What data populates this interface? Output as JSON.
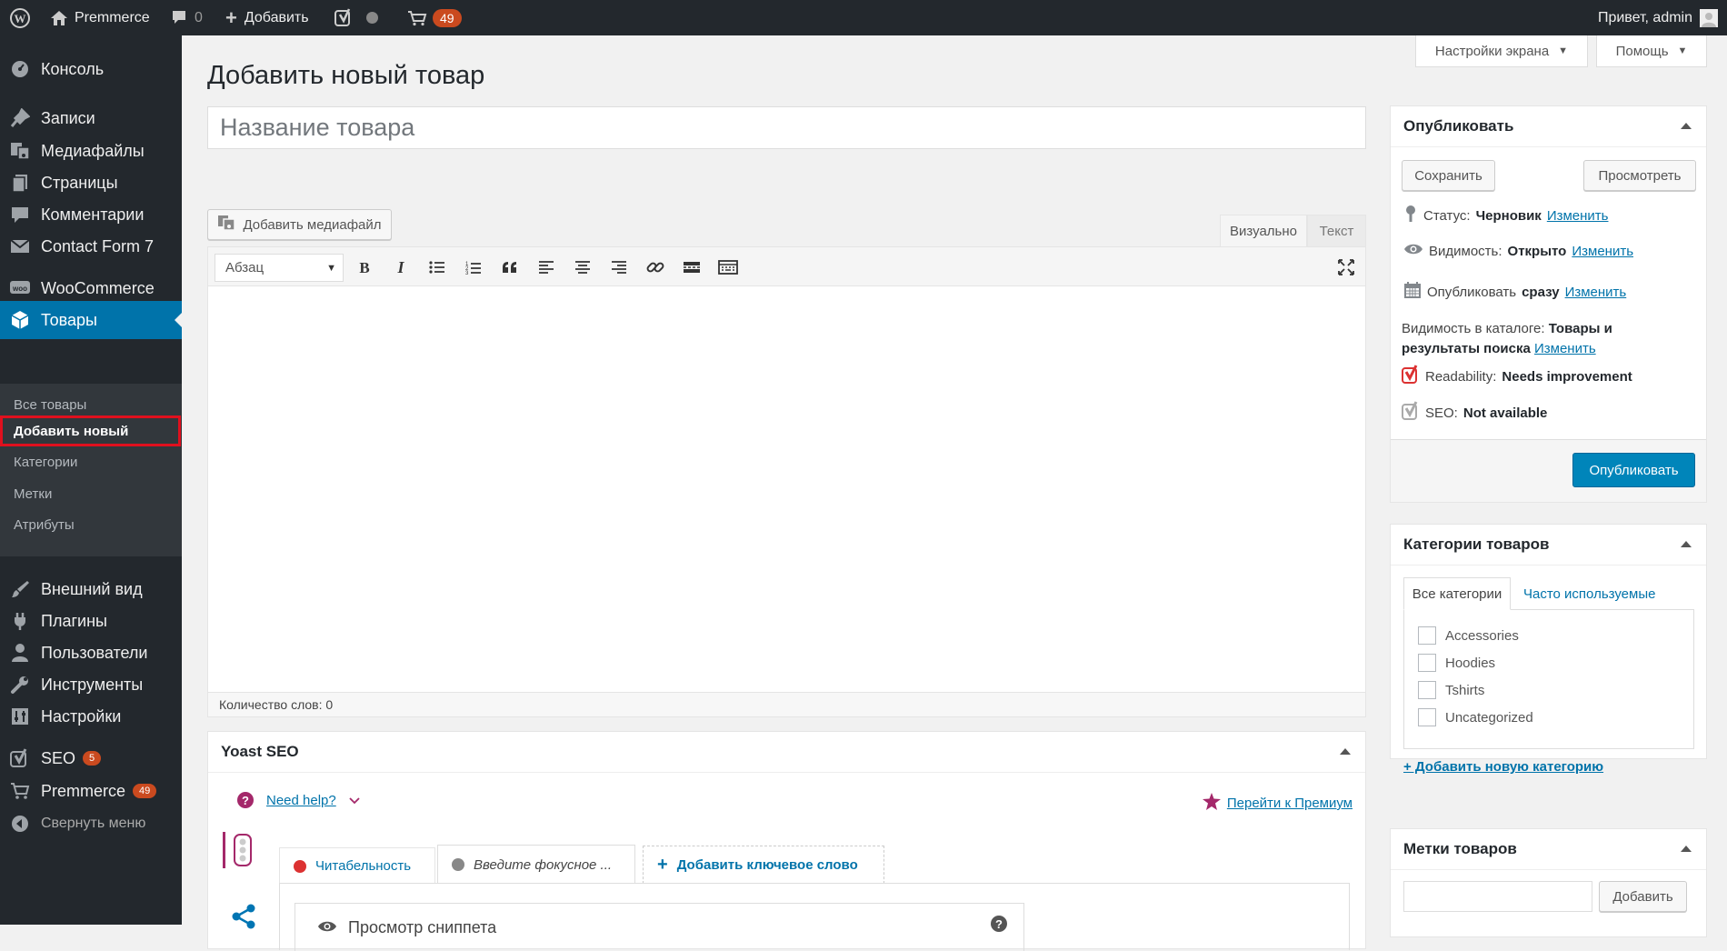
{
  "adminbar": {
    "site_name": "Premmerce",
    "comments_count": "0",
    "add_label": "Добавить",
    "cart_count": "49",
    "greeting": "Привет, admin"
  },
  "sidebar": {
    "items": [
      {
        "label": "Консоль",
        "icon": "dashboard-icon"
      },
      {
        "label": "Записи",
        "icon": "pin-icon"
      },
      {
        "label": "Медиафайлы",
        "icon": "media-icon"
      },
      {
        "label": "Страницы",
        "icon": "pages-icon"
      },
      {
        "label": "Комментарии",
        "icon": "comments-icon"
      },
      {
        "label": "Contact Form 7",
        "icon": "mail-icon"
      },
      {
        "label": "WooCommerce",
        "icon": "woo-icon"
      },
      {
        "label": "Товары",
        "icon": "box-icon"
      },
      {
        "label": "Внешний вид",
        "icon": "brush-icon"
      },
      {
        "label": "Плагины",
        "icon": "plugin-icon"
      },
      {
        "label": "Пользователи",
        "icon": "user-icon"
      },
      {
        "label": "Инструменты",
        "icon": "wrench-icon"
      },
      {
        "label": "Настройки",
        "icon": "settings-icon"
      },
      {
        "label": "SEO",
        "icon": "yoast-icon",
        "badge": "5"
      },
      {
        "label": "Premmerce",
        "icon": "cart-icon",
        "badge": "49"
      },
      {
        "label": "Свернуть меню",
        "icon": "collapse-icon"
      }
    ],
    "submenu": [
      "Все товары",
      "Добавить новый",
      "Категории",
      "Метки",
      "Атрибуты"
    ]
  },
  "screen_options": {
    "screen_label": "Настройки экрана",
    "help_label": "Помощь"
  },
  "page": {
    "title": "Добавить новый товар",
    "title_placeholder": "Название товара"
  },
  "editor": {
    "add_media": "Добавить медиафайл",
    "tab_visual": "Визуально",
    "tab_text": "Текст",
    "format": "Абзац",
    "word_count": "Количество слов: 0"
  },
  "yoast": {
    "title": "Yoast SEO",
    "help": "Need help?",
    "premium": "Перейти к Премиум",
    "tab_readability": "Читабельность",
    "tab_focus": "Введите фокусное ...",
    "tab_add": "Добавить ключевое слово",
    "snippet": "Просмотр сниппета"
  },
  "publish": {
    "title": "Опубликовать",
    "save": "Сохранить",
    "preview": "Просмотреть",
    "status_label": "Статус:",
    "status_value": "Черновик",
    "visibility_label": "Видимость:",
    "visibility_value": "Открыто",
    "publish_label": "Опубликовать",
    "publish_value": "сразу",
    "catalog_label": "Видимость в каталоге:",
    "catalog_value1": "Товары и",
    "catalog_value2": "результаты поиска",
    "edit": "Изменить",
    "readability_label": "Readability:",
    "readability_value": "Needs improvement",
    "seo_label": "SEO:",
    "seo_value": "Not available",
    "publish_button": "Опубликовать"
  },
  "categories": {
    "title": "Категории товаров",
    "tab_all": "Все категории",
    "tab_popular": "Часто используемые",
    "items": [
      "Accessories",
      "Hoodies",
      "Tshirts",
      "Uncategorized"
    ],
    "add_new": "+ Добавить новую категорию"
  },
  "tags": {
    "title": "Метки товаров",
    "add_button": "Добавить"
  },
  "colors": {
    "accent": "#0073aa",
    "badge": "#ca4a1f",
    "highlight": "#e0101e",
    "yoast_red": "#dc3232"
  }
}
